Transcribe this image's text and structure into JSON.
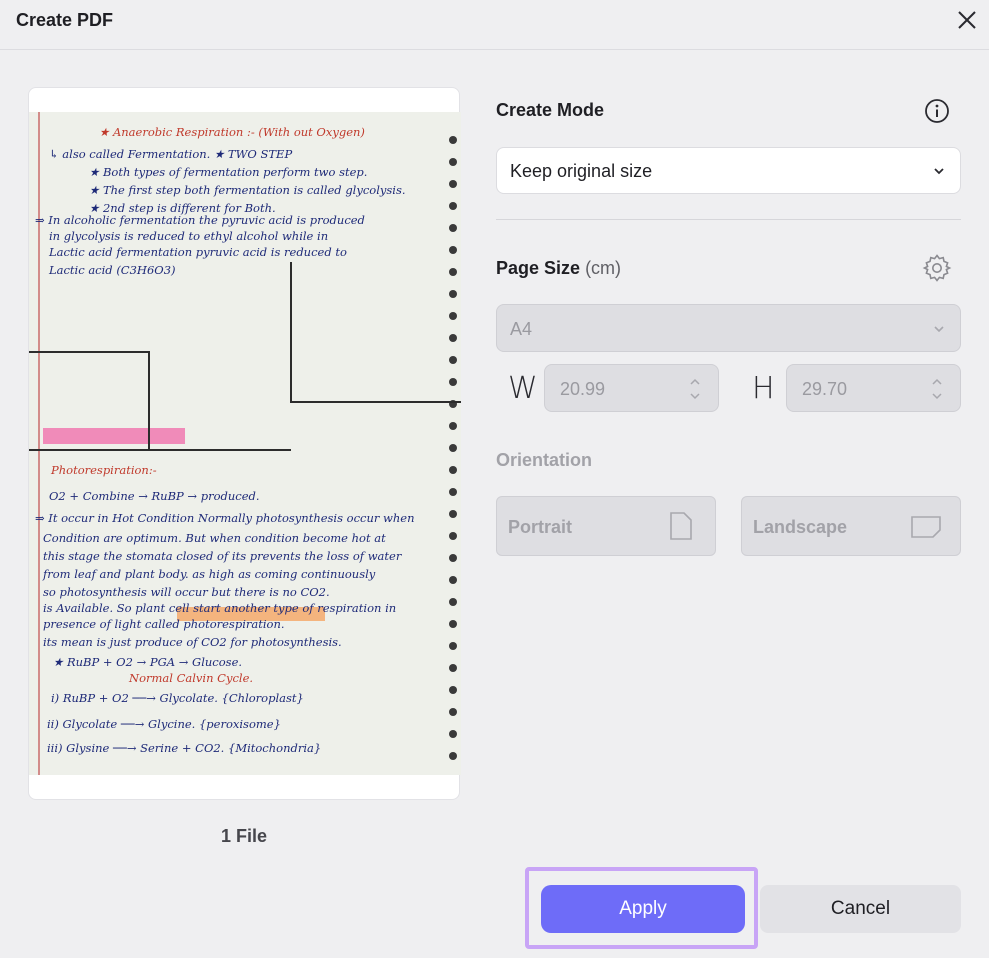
{
  "window": {
    "title": "Create PDF"
  },
  "preview": {
    "file_count": "1 File",
    "note_lines": [
      "★ Anaerobic Respiration :- (With out Oxygen)",
      "↳ also called Fermentation. ★ TWO STEP",
      "★ Both types of fermentation perform two step.",
      "★ The first step both fermentation is called glycolysis.",
      "★ 2nd step is different for Both.",
      "⇒ In alcoholic fermentation the pyruvic acid is produced",
      "in glycolysis is reduced to ethyl alcohol while in",
      "Lactic acid fermentation pyruvic acid is reduced to",
      "Lactic acid (C3H6O3)",
      "Photorespiration:-",
      "O2 + Combine → RuBP → produced.",
      "⇒ It occur in Hot Condition Normally photosynthesis occur when",
      "Condition are optimum. But when condition become hot at",
      "this stage the stomata closed of its prevents the loss of water",
      "from leaf and plant body. as high as coming continuously",
      "so photosynthesis will occur but there is no CO2.",
      "is Available. So plant cell start another type of respiration in",
      "presence of light called photorespiration.",
      "its mean is just produce of CO2 for photosynthesis.",
      "★ RuBP + O2 → PGA → Glucose.",
      "Normal Calvin Cycle.",
      "i) RuBP + O2 ──→ Glycolate. {Chloroplast}",
      "ii) Glycolate ──→ Glycine. {peroxisome}",
      "iii) Glysine ──→ Serine + CO2. {Mitochondria}"
    ]
  },
  "create_mode": {
    "label": "Create Mode",
    "selected": "Keep original size"
  },
  "page_size": {
    "label": "Page Size",
    "unit": "(cm)",
    "selected": "A4",
    "width_label": "W",
    "width_value": "20.99",
    "height_label": "H",
    "height_value": "29.70"
  },
  "orientation": {
    "label": "Orientation",
    "portrait_label": "Portrait",
    "landscape_label": "Landscape"
  },
  "buttons": {
    "apply": "Apply",
    "cancel": "Cancel"
  },
  "colors": {
    "accent": "#6e6cf8",
    "highlight": "#c8a4f6",
    "background": "#efeff1"
  }
}
